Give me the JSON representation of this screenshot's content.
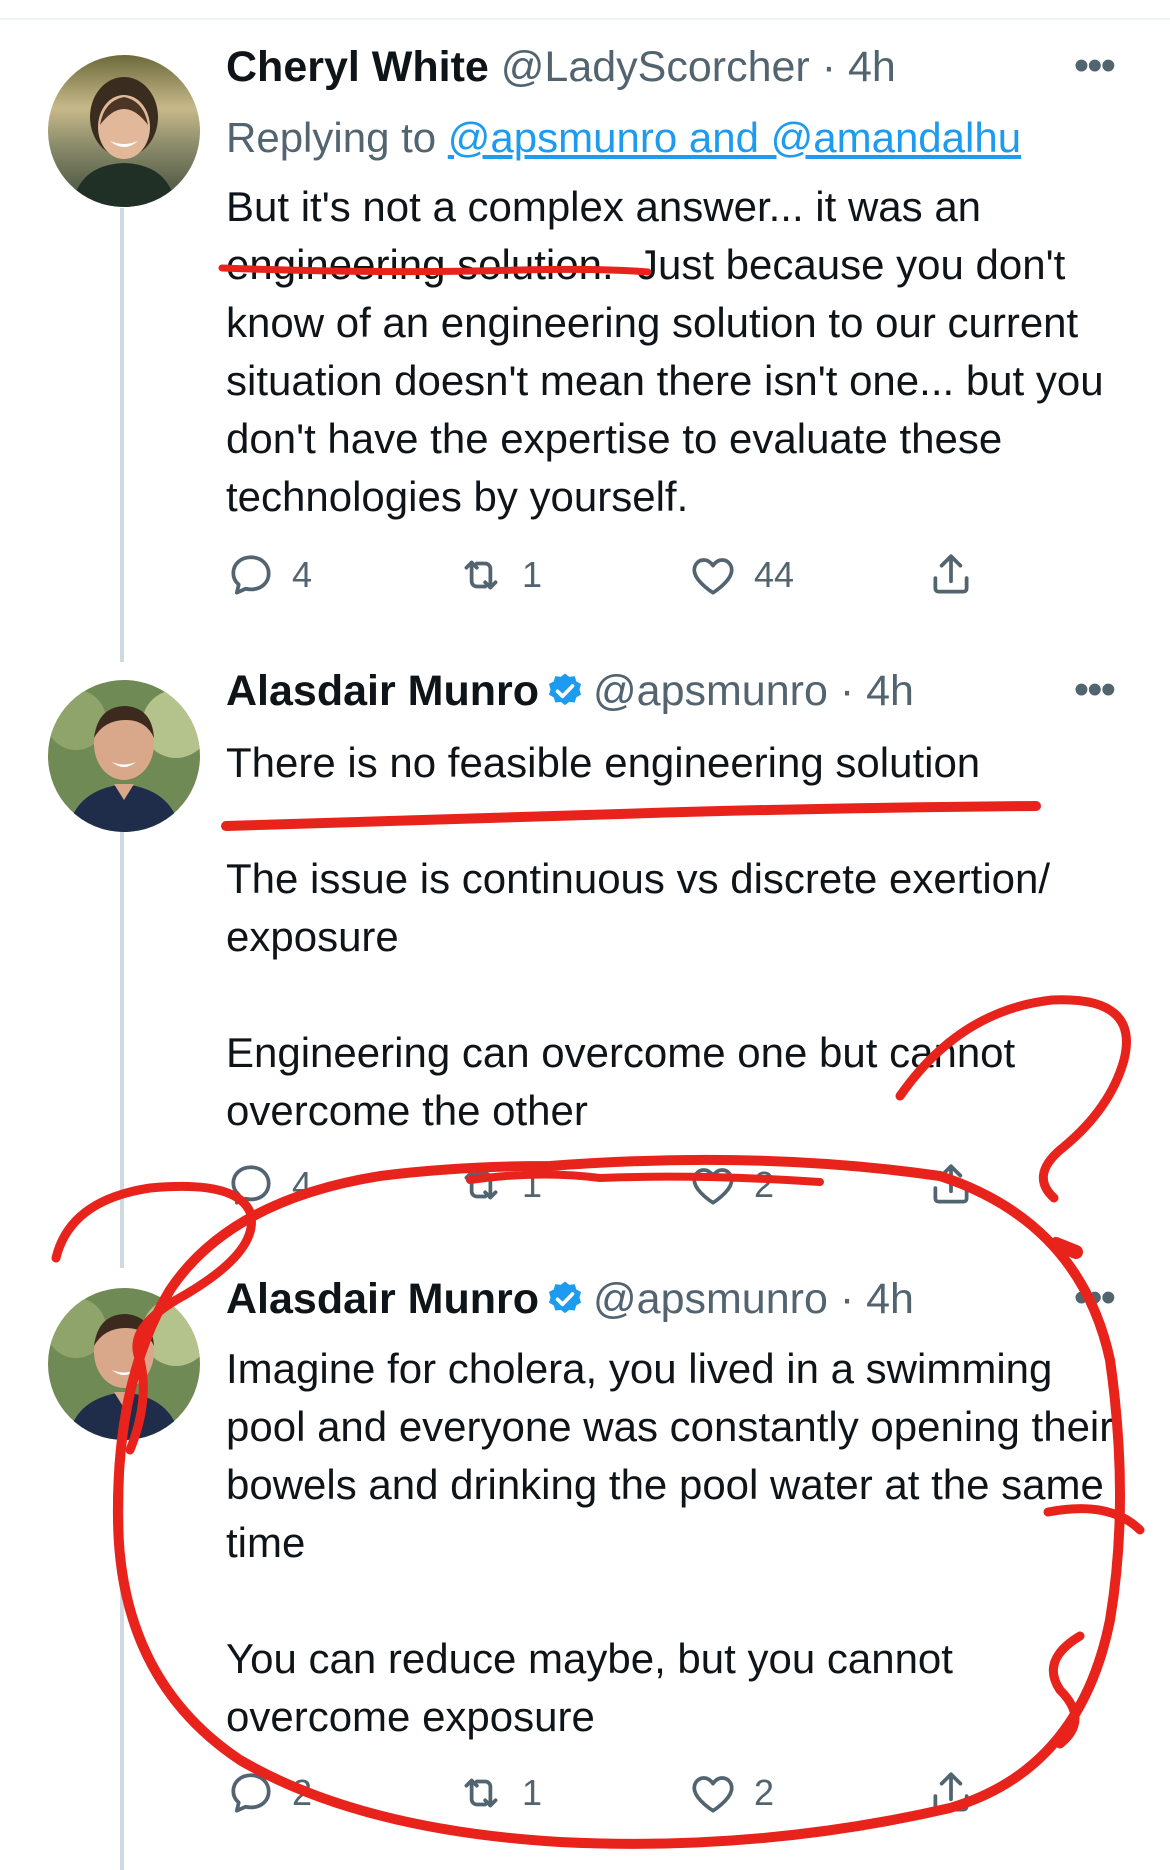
{
  "tweets": [
    {
      "name": "Cheryl White",
      "handle": "@LadyScorcher",
      "time": "· 4h",
      "verified": false,
      "replying_prefix": "Replying to ",
      "replying_to": "@apsmunro and @amandalhu",
      "text": "But it's not a complex answer... it was an engineering solution.  Just because you don't know of an engineering solution to our current situation doesn't mean there isn't one... but you don't have the expertise to evaluate these technologies by yourself.",
      "replies": "4",
      "retweets": "1",
      "likes": "44"
    },
    {
      "name": "Alasdair Munro",
      "handle": "@apsmunro",
      "time": "· 4h",
      "verified": true,
      "text": "There is no feasible engineering solution\n\nThe issue is continuous vs discrete exertion/\nexposure\n\nEngineering can overcome one but cannot overcome the other",
      "replies": "4",
      "retweets": "1",
      "likes": "2"
    },
    {
      "name": "Alasdair Munro",
      "handle": "@apsmunro",
      "time": "· 4h",
      "verified": true,
      "text": "Imagine for cholera, you lived in a swimming pool and everyone was constantly opening their bowels and drinking the pool water at the same time\n\nYou can reduce maybe, but you cannot overcome exposure",
      "replies": "2",
      "retweets": "1",
      "likes": "2"
    }
  ],
  "icons": {
    "more": "more-icon",
    "reply": "reply-icon",
    "retweet": "retweet-icon",
    "like": "like-icon",
    "share": "share-icon",
    "verified": "verified-badge-icon"
  },
  "colors": {
    "text": "#0f1419",
    "secondary": "#536471",
    "link": "#1d9bf0",
    "verified": "#1d9bf0",
    "annotation": "#e8231c",
    "thread_line": "#cfd9de"
  }
}
